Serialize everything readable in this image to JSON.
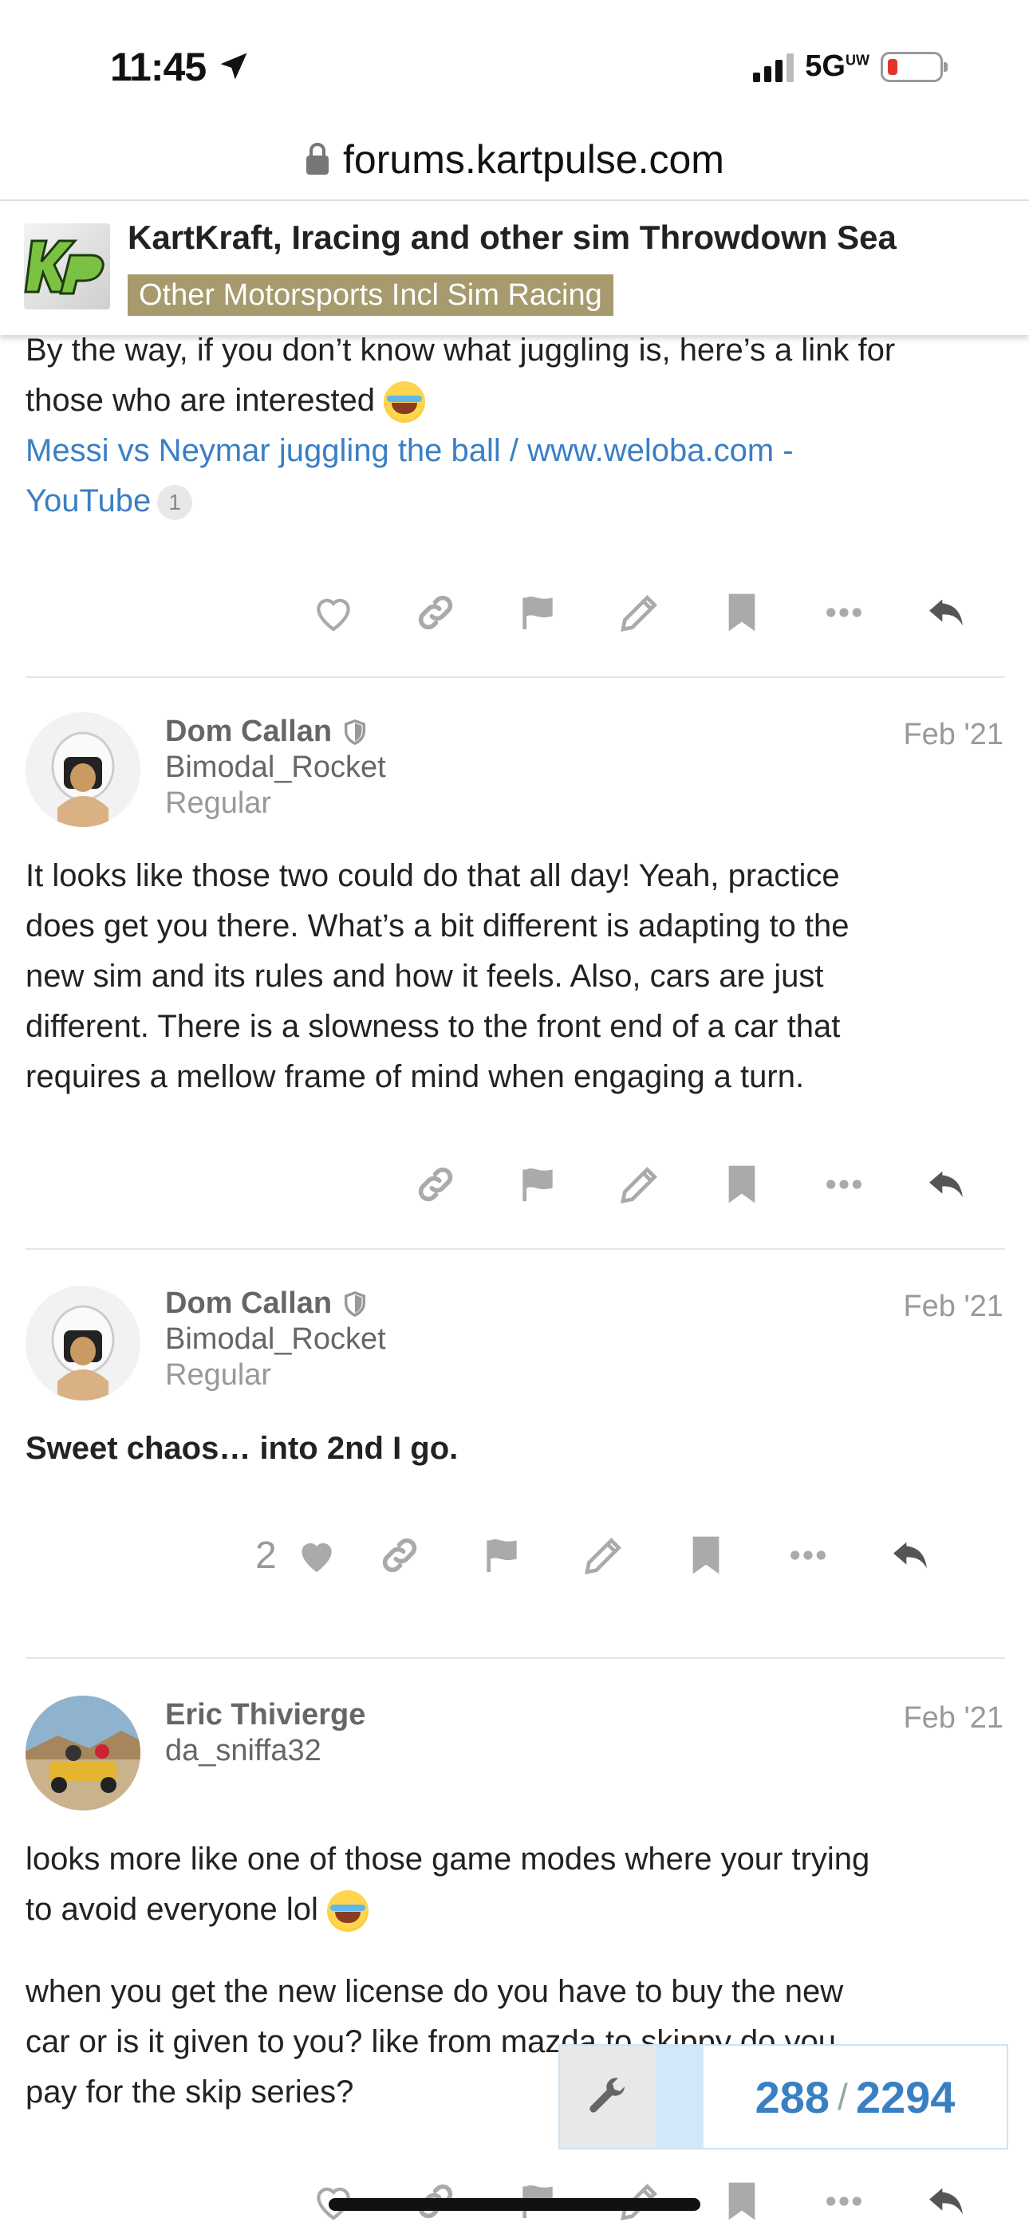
{
  "status": {
    "time": "11:45",
    "network": "5G",
    "network_sup": "UW"
  },
  "browser": {
    "url": "forums.kartpulse.com"
  },
  "topic": {
    "title": "KartKraft, Iracing and other sim Throwdown Sea",
    "category": "Other Motorsports Incl Sim Racing",
    "category_color": "#a79a6d"
  },
  "post0": {
    "line1": "By the way, if you don’t know what juggling is, here’s a link for",
    "line2": "those who are interested",
    "link_line1": "Messi vs Neymar juggling the ball / www.weloba.com -",
    "link_line2": "YouTube",
    "link_clicks": "1"
  },
  "post1": {
    "name": "Dom Callan",
    "handle": "Bimodal_Rocket",
    "title": "Regular",
    "date": "Feb '21",
    "lines": [
      "It looks like those two could do that all day! Yeah, practice",
      "does get you there. What’s a bit different is adapting to the",
      "new sim and its rules and how it feels. Also, cars are just",
      "different. There is a slowness to the front end of a car that",
      "requires a mellow frame of mind when engaging a turn."
    ]
  },
  "post2": {
    "name": "Dom Callan",
    "handle": "Bimodal_Rocket",
    "title": "Regular",
    "date": "Feb '21",
    "body": "Sweet chaos… into 2nd I go.",
    "likes": "2"
  },
  "post3": {
    "name": "Eric Thivierge",
    "handle": "da_sniffa32",
    "date": "Feb '21",
    "p1_line1": "looks more like one of those game modes where your trying",
    "p1_line2": "to avoid everyone lol",
    "p2_line1": "when you get the new license do you have to buy the new",
    "p2_line2": "car or is it given to you? like from mazda to skippy do you",
    "p2_line3": "pay for the skip series?"
  },
  "progress": {
    "current": "288",
    "separator": "/",
    "total": "2294"
  },
  "colors": {
    "link": "#3a7fc4",
    "icon": "#aaaaaa",
    "reply_icon": "#555555"
  },
  "icons": [
    "location-arrow-icon",
    "lock-icon",
    "heart-icon",
    "link-icon",
    "flag-icon",
    "pencil-icon",
    "bookmark-icon",
    "more-icon",
    "reply-icon",
    "shield-icon",
    "wrench-icon"
  ]
}
